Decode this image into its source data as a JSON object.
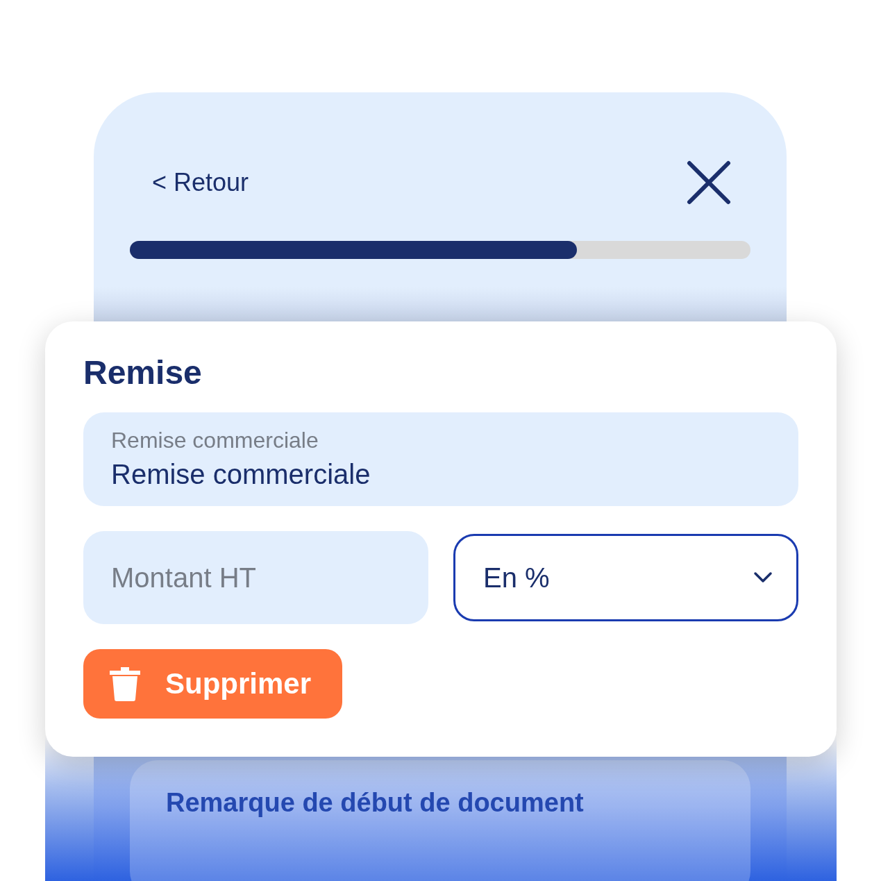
{
  "header": {
    "back_link": "< Retour"
  },
  "progress": {
    "level": 0.72
  },
  "card": {
    "title": "Remise",
    "fields": [
      {
        "kind": "labeled",
        "label": "Remise commerciale",
        "value": "Remise commerciale"
      },
      {
        "kind": "input",
        "placeholder": "Montant HT"
      },
      {
        "kind": "select",
        "value": "En %"
      }
    ],
    "delete_button": "Supprimer"
  },
  "remark": {
    "title": "Remarque de début de document"
  }
}
